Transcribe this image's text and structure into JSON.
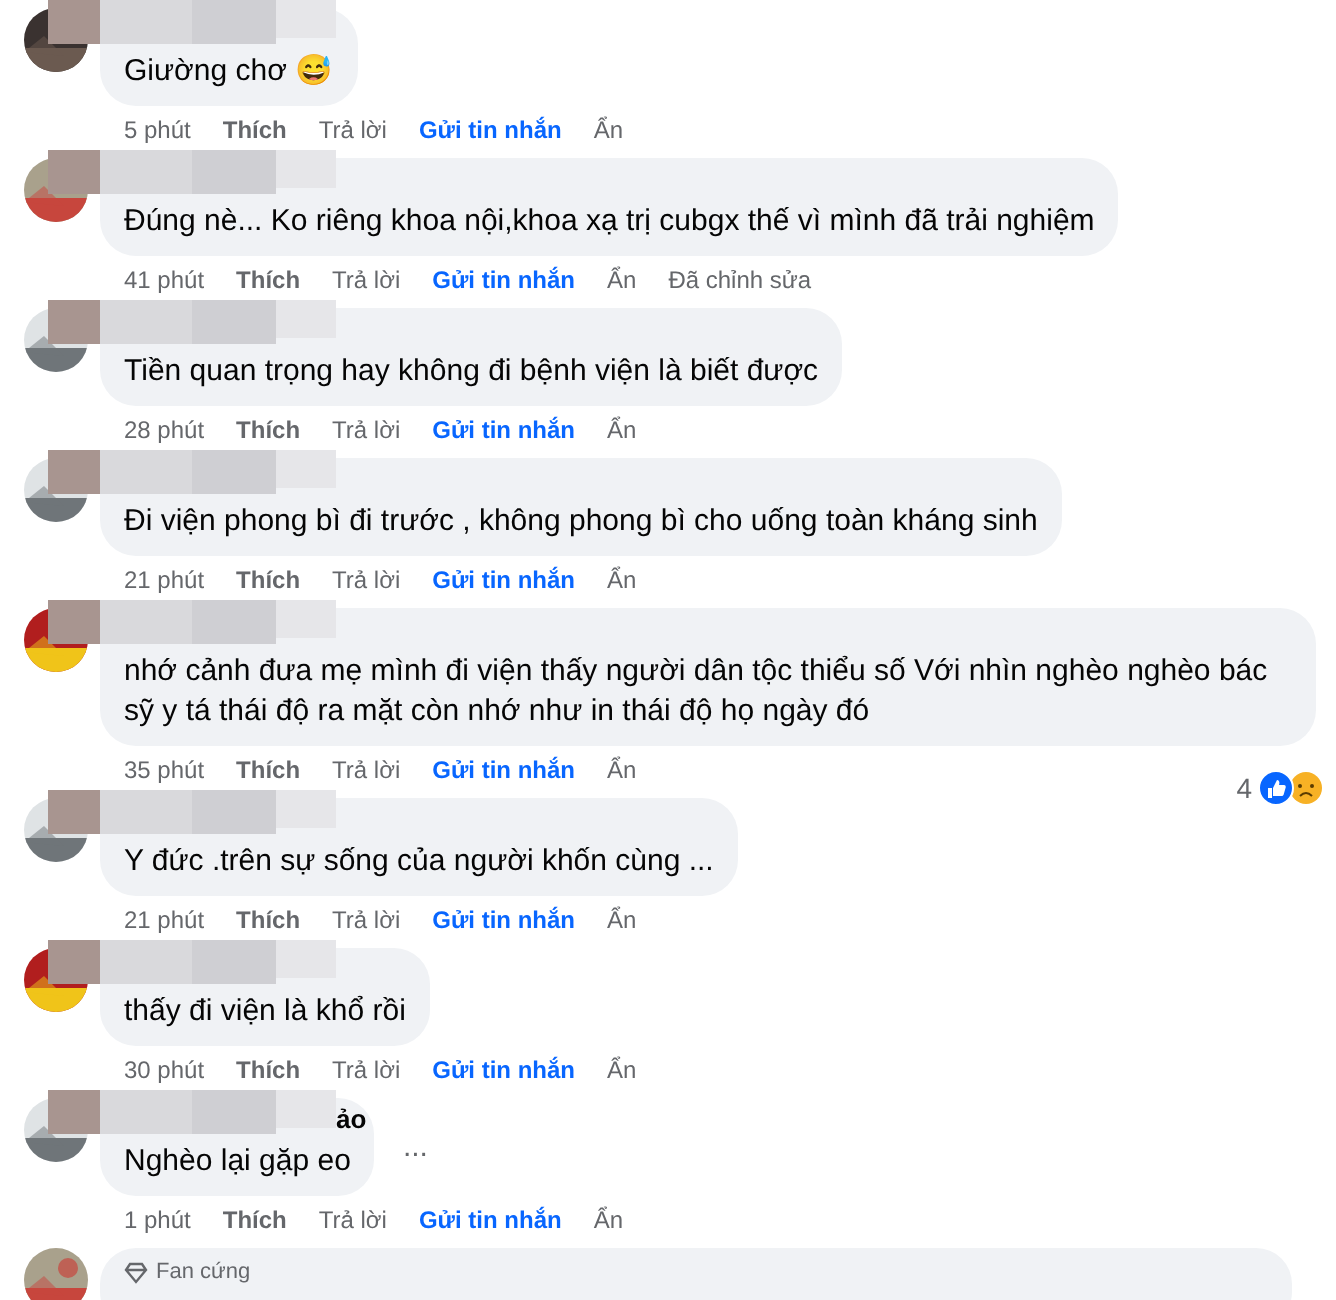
{
  "comments": [
    {
      "text": "Giường chơ 😅",
      "actions": [
        {
          "kind": "time",
          "label": "5 phút"
        },
        {
          "kind": "like",
          "label": "Thích"
        },
        {
          "kind": "reply",
          "label": "Trả lời"
        },
        {
          "kind": "message",
          "label": "Gửi tin nhắn"
        },
        {
          "kind": "hide",
          "label": "Ẩn"
        }
      ]
    },
    {
      "text": "Đúng nè... Ko riêng khoa nội,khoa xạ trị cubgx thế vì mình đã trải nghiệm",
      "actions": [
        {
          "kind": "time",
          "label": "41 phút"
        },
        {
          "kind": "like",
          "label": "Thích"
        },
        {
          "kind": "reply",
          "label": "Trả lời"
        },
        {
          "kind": "message",
          "label": "Gửi tin nhắn"
        },
        {
          "kind": "hide",
          "label": "Ẩn"
        },
        {
          "kind": "edited",
          "label": "Đã chỉnh sửa"
        }
      ]
    },
    {
      "text": "Tiền quan trọng hay không đi bệnh viện là biết được",
      "actions": [
        {
          "kind": "time",
          "label": "28 phút"
        },
        {
          "kind": "like",
          "label": "Thích"
        },
        {
          "kind": "reply",
          "label": "Trả lời"
        },
        {
          "kind": "message",
          "label": "Gửi tin nhắn"
        },
        {
          "kind": "hide",
          "label": "Ẩn"
        }
      ]
    },
    {
      "text": "Đi viện phong bì đi trước , không phong bì cho uống toàn kháng sinh",
      "actions": [
        {
          "kind": "time",
          "label": "21 phút"
        },
        {
          "kind": "like",
          "label": "Thích"
        },
        {
          "kind": "reply",
          "label": "Trả lời"
        },
        {
          "kind": "message",
          "label": "Gửi tin nhắn"
        },
        {
          "kind": "hide",
          "label": "Ẩn"
        }
      ]
    },
    {
      "text": "nhớ cảnh đưa mẹ mình đi viện thấy người dân tộc thiểu số Với nhìn nghèo nghèo bác sỹ y tá thái độ ra mặt còn nhớ như in thái độ họ ngày đó",
      "reactions": {
        "count": "4"
      },
      "actions": [
        {
          "kind": "time",
          "label": "35 phút"
        },
        {
          "kind": "like",
          "label": "Thích"
        },
        {
          "kind": "reply",
          "label": "Trả lời"
        },
        {
          "kind": "message",
          "label": "Gửi tin nhắn"
        },
        {
          "kind": "hide",
          "label": "Ẩn"
        }
      ]
    },
    {
      "text": "Y đức .trên sự sống của người khốn cùng ...",
      "actions": [
        {
          "kind": "time",
          "label": "21 phút"
        },
        {
          "kind": "like",
          "label": "Thích"
        },
        {
          "kind": "reply",
          "label": "Trả lời"
        },
        {
          "kind": "message",
          "label": "Gửi tin nhắn"
        },
        {
          "kind": "hide",
          "label": "Ẩn"
        }
      ]
    },
    {
      "text": "thấy đi viện là khổ rồi",
      "actions": [
        {
          "kind": "time",
          "label": "30 phút"
        },
        {
          "kind": "like",
          "label": "Thích"
        },
        {
          "kind": "reply",
          "label": "Trả lời"
        },
        {
          "kind": "message",
          "label": "Gửi tin nhắn"
        },
        {
          "kind": "hide",
          "label": "Ẩn"
        }
      ]
    },
    {
      "name_tail": "ảo",
      "more": "...",
      "text": "Nghèo lại gặp eo",
      "actions": [
        {
          "kind": "time",
          "label": "1 phút"
        },
        {
          "kind": "like",
          "label": "Thích"
        },
        {
          "kind": "reply",
          "label": "Trả lời"
        },
        {
          "kind": "message",
          "label": "Gửi tin nhắn"
        },
        {
          "kind": "hide",
          "label": "Ẩn"
        }
      ]
    },
    {
      "badge": "Fan cứng"
    }
  ]
}
